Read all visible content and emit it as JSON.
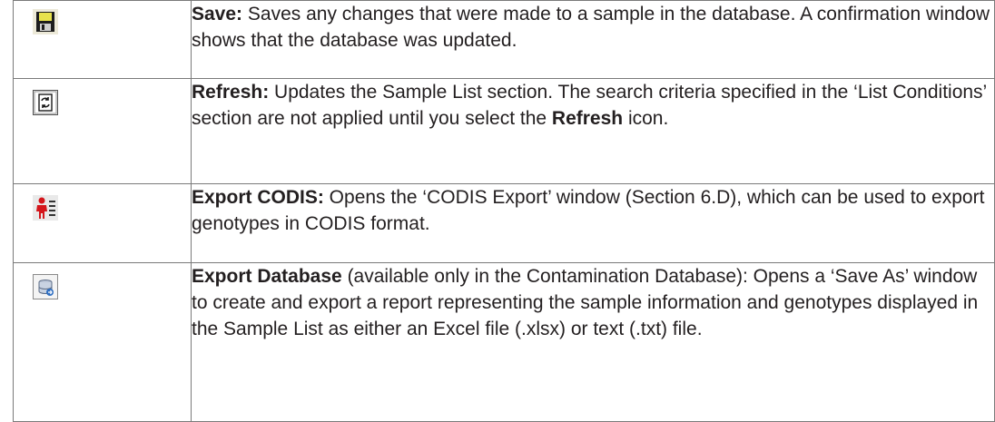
{
  "rows": [
    {
      "icon": "save-disk-icon",
      "title": "Save:",
      "text": " Saves any changes that were made to a sample in the database. A confirmation window shows that the database was updated."
    },
    {
      "icon": "refresh-icon",
      "title": "Refresh:",
      "text_a": " Updates the Sample List section. The search criteria specified in the ‘List Conditions’ section are not applied until you select the ",
      "bold_inline": "Refresh",
      "text_b": " icon."
    },
    {
      "icon": "export-codis-icon",
      "title": "Export CODIS:",
      "text": " Opens the ‘CODIS Export’ window (Section 6.D), which can be used to export genotypes in CODIS format."
    },
    {
      "icon": "export-database-icon",
      "title": "Export Database",
      "text": " (available only in the Contamination Database): Opens a ‘Save As’ window to create and export a report representing the sample information and genotypes displayed in the Sample List as either an Excel file (.xlsx) or text (.txt) file."
    }
  ]
}
